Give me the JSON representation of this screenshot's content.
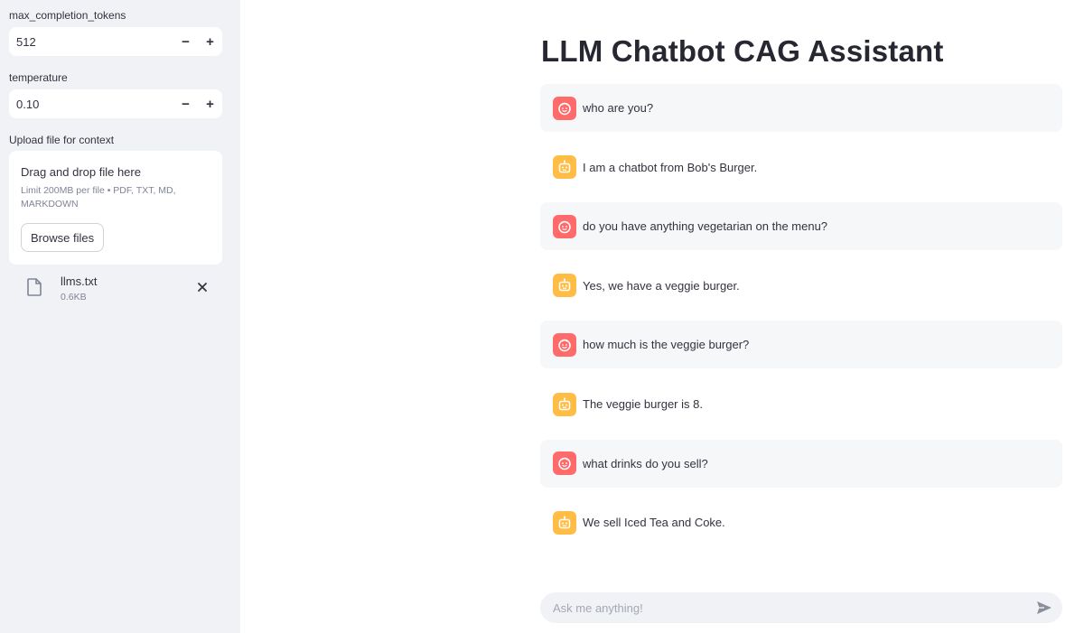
{
  "sidebar": {
    "max_tokens": {
      "label": "max_completion_tokens",
      "value": "512",
      "minus": "−",
      "plus": "+"
    },
    "temperature": {
      "label": "temperature",
      "value": "0.10",
      "minus": "−",
      "plus": "+"
    },
    "upload": {
      "label": "Upload file for context",
      "drop_title": "Drag and drop file here",
      "limit_text": "Limit 200MB per file • PDF, TXT, MD, MARKDOWN",
      "browse_label": "Browse files",
      "file": {
        "name": "llms.txt",
        "size": "0.6KB",
        "icon": "file-icon"
      }
    }
  },
  "main": {
    "title": "LLM Chatbot CAG Assistant",
    "messages": [
      {
        "role": "user",
        "text": "who are you?"
      },
      {
        "role": "assistant",
        "text": "I am a chatbot from Bob's Burger."
      },
      {
        "role": "user",
        "text": "do you have anything vegetarian on the menu?"
      },
      {
        "role": "assistant",
        "text": "Yes, we have a veggie burger."
      },
      {
        "role": "user",
        "text": "how much is the veggie burger?"
      },
      {
        "role": "assistant",
        "text": "The veggie burger is 8."
      },
      {
        "role": "user",
        "text": "what drinks do you sell?"
      },
      {
        "role": "assistant",
        "text": "We sell Iced Tea and Coke."
      }
    ],
    "chat_input": {
      "placeholder": "Ask me anything!",
      "send_icon": "send-icon"
    }
  },
  "colors": {
    "sidebar_bg": "#f0f2f6",
    "user_avatar": "#ff6b6b",
    "assistant_avatar": "#ffbd45",
    "user_msg_bg": "#f6f7f9"
  }
}
